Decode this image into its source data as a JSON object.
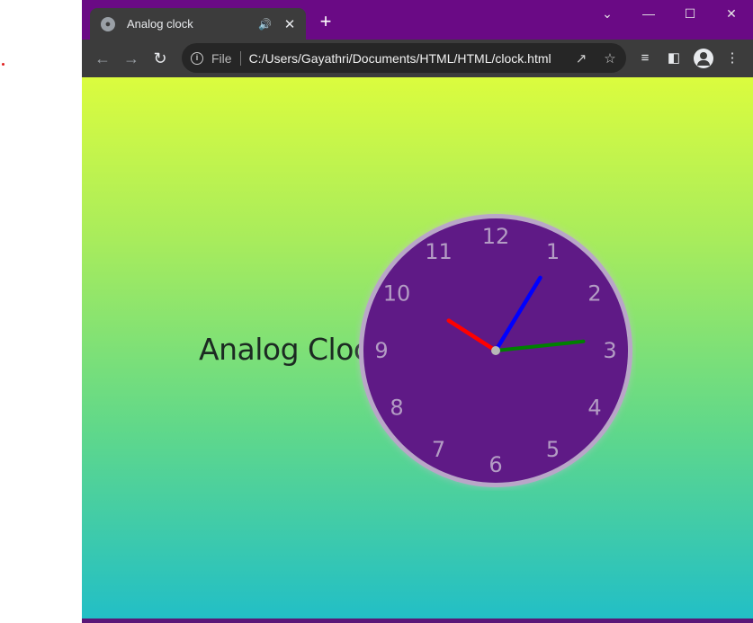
{
  "tab": {
    "title": "Analog clock",
    "audio_icon": "speaker-icon",
    "close_icon": "close-icon"
  },
  "window_controls": {
    "dropdown": "chevron-down-icon",
    "minimize": "minimize-icon",
    "maximize": "maximize-icon",
    "close": "close-icon"
  },
  "address_bar": {
    "scheme_label": "File",
    "url": "C:/Users/Gayathri/Documents/HTML/HTML/clock.html"
  },
  "page": {
    "heading": "Analog Clock",
    "clock": {
      "numbers": [
        "12",
        "1",
        "2",
        "3",
        "4",
        "5",
        "6",
        "7",
        "8",
        "9",
        "10",
        "11"
      ],
      "time": {
        "hours": 10,
        "minutes": 5,
        "seconds": 14
      },
      "hand_colors": {
        "hour": "#ff0000",
        "minute": "#0000ff",
        "second": "#008000"
      },
      "face_color": "#5f1a86",
      "rim_color": "#b9a6c8",
      "numeral_color": "#b39cc4"
    }
  },
  "colors": {
    "window_frame": "#6a0a85",
    "toolbar": "#3c3c3c",
    "gradient_top": "#dbfc3e",
    "gradient_bottom": "#22bfc6"
  }
}
